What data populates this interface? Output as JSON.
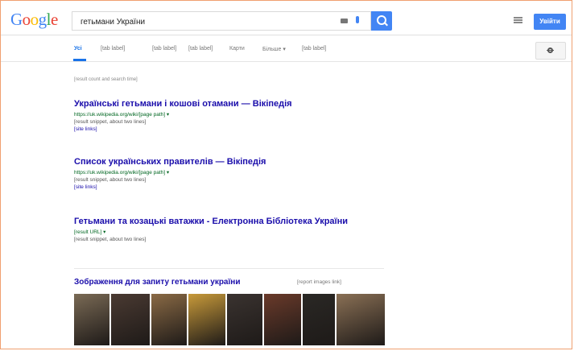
{
  "logo": [
    "G",
    "o",
    "o",
    "g",
    "l",
    "e"
  ],
  "search": {
    "query": "гетьмани України",
    "placeholder": ""
  },
  "header": {
    "signin_label": "Увійти"
  },
  "tabs": [
    {
      "label": "Усі",
      "active": true
    },
    {
      "label": "[tab label]"
    },
    {
      "label": "[tab label]"
    },
    {
      "label": "[tab label]"
    },
    {
      "label": "Карти"
    },
    {
      "label": "Більше ▾"
    },
    {
      "label": "[tab label]"
    }
  ],
  "stats": "[result count and search time]",
  "results": [
    {
      "title": "Українські гетьмани і кошові отамани — Вікіпедія",
      "url": "https://uk.wikipedia.org/wiki/[page path] ▾",
      "snippet": "[result snippet, about two lines]",
      "sitelinks": "[site links]"
    },
    {
      "title": "Список українських правителів — Вікіпедія",
      "url": "https://uk.wikipedia.org/wiki/[page path] ▾",
      "snippet": "[result snippet, about two lines]",
      "sitelinks": "[site links]"
    },
    {
      "title": "Гетьмани та козацькі ватажки - Електронна Бібліотека України",
      "url": "[result URL] ▾",
      "snippet": "[result snippet, about two lines]",
      "sitelinks": ""
    }
  ],
  "images": {
    "title": "Зображення для запиту гетьмани україни",
    "report_label": "[report images link]",
    "thumbs": [
      {
        "color": "#7a6a55"
      },
      {
        "color": "#4a3a32"
      },
      {
        "color": "#8a6a45"
      },
      {
        "color": "#c89a3a"
      },
      {
        "color": "#3a3330"
      },
      {
        "color": "#6a3a2a"
      },
      {
        "color": "#2a2825"
      },
      {
        "color": "#8a7055"
      }
    ]
  },
  "colors": {
    "accent": "#4285f4",
    "link": "#1a0dab",
    "url": "#006621"
  }
}
